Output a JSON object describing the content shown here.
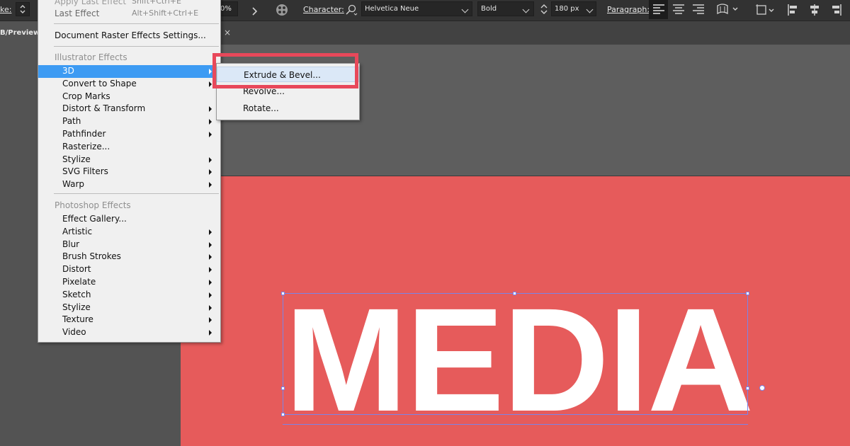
{
  "control_bar": {
    "stroke_label": "ke:",
    "percent_fragment": "0%",
    "character_label": "Character:",
    "font_family": "Helvetica Neue",
    "font_style": "Bold",
    "font_size": "180 px",
    "paragraph_label": "Paragraph:"
  },
  "tabs": {
    "document_tab_fragment": "B/Preview",
    "close_glyph": "×"
  },
  "effect_menu": {
    "apply_last_effect": "Apply Last Effect",
    "apply_last_shortcut": "Shift+Ctrl+E",
    "last_effect": "Last Effect",
    "last_effect_shortcut": "Alt+Shift+Ctrl+E",
    "document_raster_settings": "Document Raster Effects Settings...",
    "illustrator_header": "Illustrator Effects",
    "illustrator_items": [
      {
        "label": "3D",
        "submenu": true,
        "highlighted": true
      },
      {
        "label": "Convert to Shape",
        "submenu": true
      },
      {
        "label": "Crop Marks",
        "submenu": false
      },
      {
        "label": "Distort & Transform",
        "submenu": true
      },
      {
        "label": "Path",
        "submenu": true
      },
      {
        "label": "Pathfinder",
        "submenu": true
      },
      {
        "label": "Rasterize...",
        "submenu": false
      },
      {
        "label": "Stylize",
        "submenu": true
      },
      {
        "label": "SVG Filters",
        "submenu": true
      },
      {
        "label": "Warp",
        "submenu": true
      }
    ],
    "photoshop_header": "Photoshop Effects",
    "photoshop_items": [
      {
        "label": "Effect Gallery...",
        "submenu": false
      },
      {
        "label": "Artistic",
        "submenu": true
      },
      {
        "label": "Blur",
        "submenu": true
      },
      {
        "label": "Brush Strokes",
        "submenu": true
      },
      {
        "label": "Distort",
        "submenu": true
      },
      {
        "label": "Pixelate",
        "submenu": true
      },
      {
        "label": "Sketch",
        "submenu": true
      },
      {
        "label": "Stylize",
        "submenu": true
      },
      {
        "label": "Texture",
        "submenu": true
      },
      {
        "label": "Video",
        "submenu": true
      }
    ]
  },
  "submenu_3d": {
    "items": [
      "Extrude & Bevel...",
      "Revolve...",
      "Rotate..."
    ],
    "hovered_index": 0
  },
  "artboard": {
    "text": "MEDIA"
  },
  "colors": {
    "artboard_fill": "#e65b5b",
    "highlight_blue": "#3d9bf3",
    "callout_red": "#e8485a",
    "selection_blue": "#7a84e8"
  }
}
